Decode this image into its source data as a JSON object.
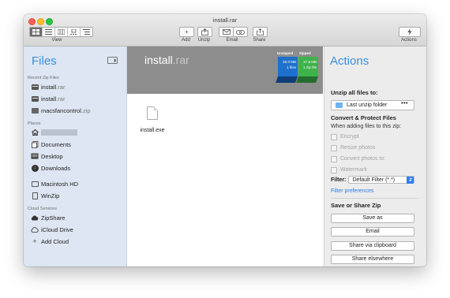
{
  "window": {
    "title": "install.rar"
  },
  "toolbar": {
    "view_label": "View",
    "add_label": "Add",
    "unzip_label": "Unzip",
    "email_label": "Email",
    "share_label": "Share",
    "actions_label": "Actions"
  },
  "sidebar": {
    "title": "Files",
    "recent_header": "Recent Zip Files",
    "recent": [
      {
        "name": "install",
        "ext": ".rar"
      },
      {
        "name": "install",
        "ext": ".rar"
      },
      {
        "name": "macsfancontrol",
        "ext": ".zip"
      }
    ],
    "places_header": "Places",
    "places": [
      "Documents",
      "Desktop",
      "Downloads"
    ],
    "drives": [
      "Macintosh HD",
      "WinZip"
    ],
    "cloud_header": "Cloud Services",
    "cloud": [
      "ZipShare",
      "iCloud Drive",
      "Add Cloud"
    ]
  },
  "archive": {
    "name": "install",
    "ext": ".rar",
    "unzipped_label": "Unzipped",
    "zipped_label": "Zipped",
    "unzipped_size": "50.0 MB",
    "unzipped_files": "1 files",
    "zipped_size": "27.8 MB",
    "zipped_files": "1 Zip file",
    "files": [
      {
        "name": "install.exe"
      }
    ]
  },
  "actions": {
    "title": "Actions",
    "unzip_header": "Unzip all files to:",
    "folder": "Last unzip folder",
    "more": "•••",
    "convert_header": "Convert & Protect Files",
    "convert_sub": "When adding files to this zip:",
    "options": [
      "Encrypt",
      "Resize photos",
      "Convert photos to:",
      "Watermark"
    ],
    "filter_label": "Filter:",
    "filter_value": "Default Filter (*.*)",
    "filter_link": "Filter preferences",
    "share_header": "Save or Share Zip",
    "buttons": [
      "Save as",
      "Email",
      "Share via clipboard",
      "Share elsewhere"
    ]
  }
}
